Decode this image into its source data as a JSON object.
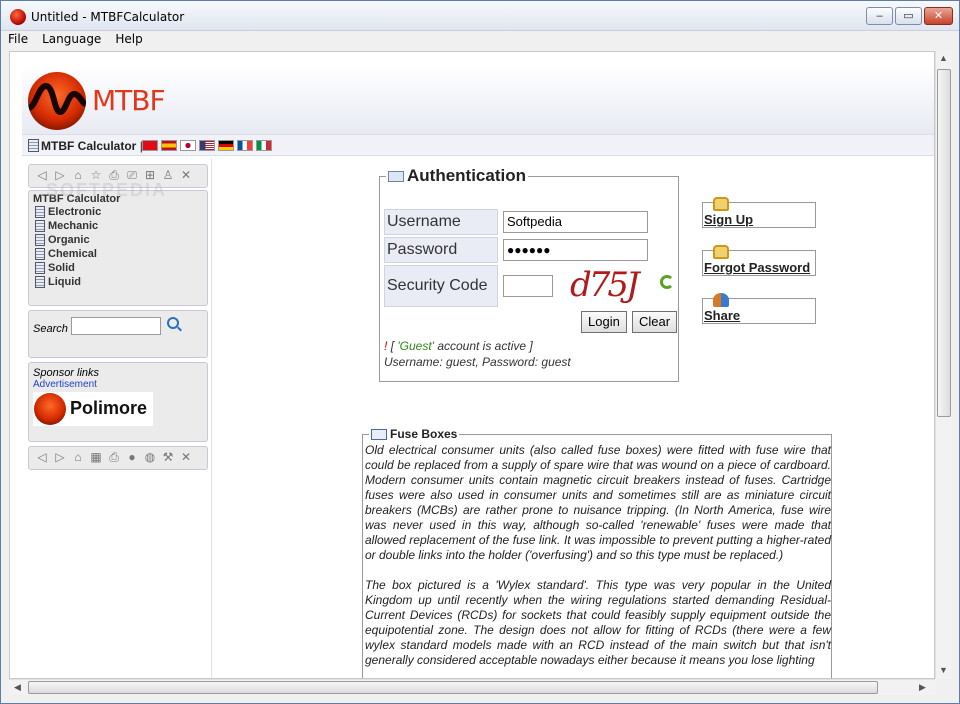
{
  "window": {
    "title": "Untitled - MTBFCalculator"
  },
  "menu": [
    "File",
    "Language",
    "Help"
  ],
  "logo": {
    "text": "MTBF"
  },
  "nav": {
    "title": "MTBF Calculator",
    "separator": "|"
  },
  "flags": [
    "turkey",
    "spain",
    "japan",
    "usa",
    "germany",
    "france",
    "italy"
  ],
  "sidebar": {
    "calc_title": "MTBF Calculator",
    "items": [
      "Electronic",
      "Mechanic",
      "Organic",
      "Chemical",
      "Solid",
      "Liquid"
    ],
    "search_label": "Search",
    "sponsor_title": "Sponsor links",
    "advertisement": "Advertisement",
    "sponsor_logo": "Polimore"
  },
  "auth": {
    "title": "Authentication",
    "username_label": "Username",
    "username_value": "Softpedia",
    "password_label": "Password",
    "password_value": "●●●●●●",
    "security_label": "Security Code",
    "captcha": "d75J",
    "login_label": "Login",
    "clear_label": "Clear",
    "note_bang": "!",
    "note_open": "[",
    "note_guest": "'Guest'",
    "note_rest": " account is active ]",
    "note_creds": "Username: guest, Password: guest"
  },
  "actions": [
    "Sign Up",
    "Forgot Password",
    "Share"
  ],
  "fuse": {
    "title": "Fuse Boxes",
    "paragraphs": [
      "Old electrical consumer units (also called fuse boxes) were fitted with fuse wire that could be replaced from a supply of spare wire that was wound on a piece of cardboard. Modern consumer units contain magnetic circuit breakers instead of fuses. Cartridge fuses were also used in consumer units and sometimes still are as miniature circuit breakers (MCBs) are rather prone to nuisance tripping. (In North America, fuse wire was never used in this way, although so-called 'renewable' fuses were made that allowed replacement of the fuse link. It was impossible to prevent putting a higher-rated or double links into the holder ('overfusing') and so this type must be replaced.)",
      "The box pictured is a 'Wylex standard'. This type was very popular in the United Kingdom up until recently when the wiring regulations started demanding Residual-Current Devices (RCDs) for sockets that could feasibly supply equipment outside the equipotential zone. The design does not allow for fitting of RCDs (there were a few wylex standard models made with an RCD instead of the main switch but that isn't generally considered acceptable nowadays either because it means you lose lighting"
    ]
  },
  "watermark": "SOFTPEDIA"
}
